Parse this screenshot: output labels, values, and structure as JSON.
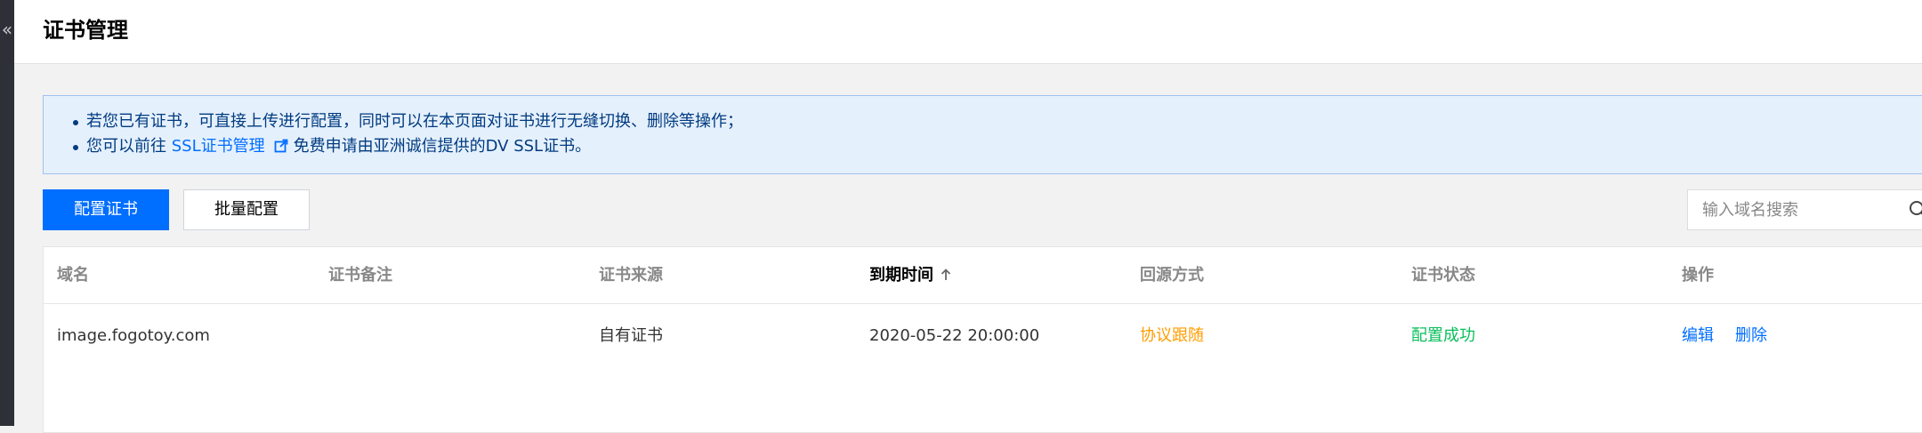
{
  "sidebar": {
    "collapse_glyph": "«",
    "collapse_icon": "chevron-double-left-icon"
  },
  "header": {
    "title": "证书管理"
  },
  "notice": {
    "line1": "若您已有证书，可直接上传进行配置，同时可以在本页面对证书进行无缝切换、删除等操作；",
    "line2_prefix": "您可以前往 ",
    "line2_link": "SSL证书管理",
    "line2_link_icon": "external-link-icon",
    "line2_suffix": "免费申请由亚洲诚信提供的DV SSL证书。"
  },
  "toolbar": {
    "configure_label": "配置证书",
    "batch_label": "批量配置"
  },
  "search": {
    "placeholder": "输入域名搜索",
    "value": "",
    "icon": "search-icon"
  },
  "table": {
    "columns": [
      "域名",
      "证书备注",
      "证书来源",
      "到期时间",
      "回源方式",
      "证书状态",
      "操作"
    ],
    "sorted_column": "到期时间",
    "sort_icon": "arrow-up-icon",
    "rows": [
      {
        "domain": "image.fogotoy.com",
        "note": "",
        "source": "自有证书",
        "expiry": "2020-05-22 20:00:00",
        "origin_mode": "协议跟随",
        "status": "配置成功",
        "actions": [
          "编辑",
          "删除"
        ]
      }
    ]
  },
  "colors": {
    "primary": "#006eff",
    "notice_bg": "#e5f0fd",
    "notice_border": "#9cc2ef",
    "notice_text": "#003b80",
    "warning": "#ff9d00",
    "success": "#0abf5b",
    "sidebar_bg": "#2d3137"
  }
}
